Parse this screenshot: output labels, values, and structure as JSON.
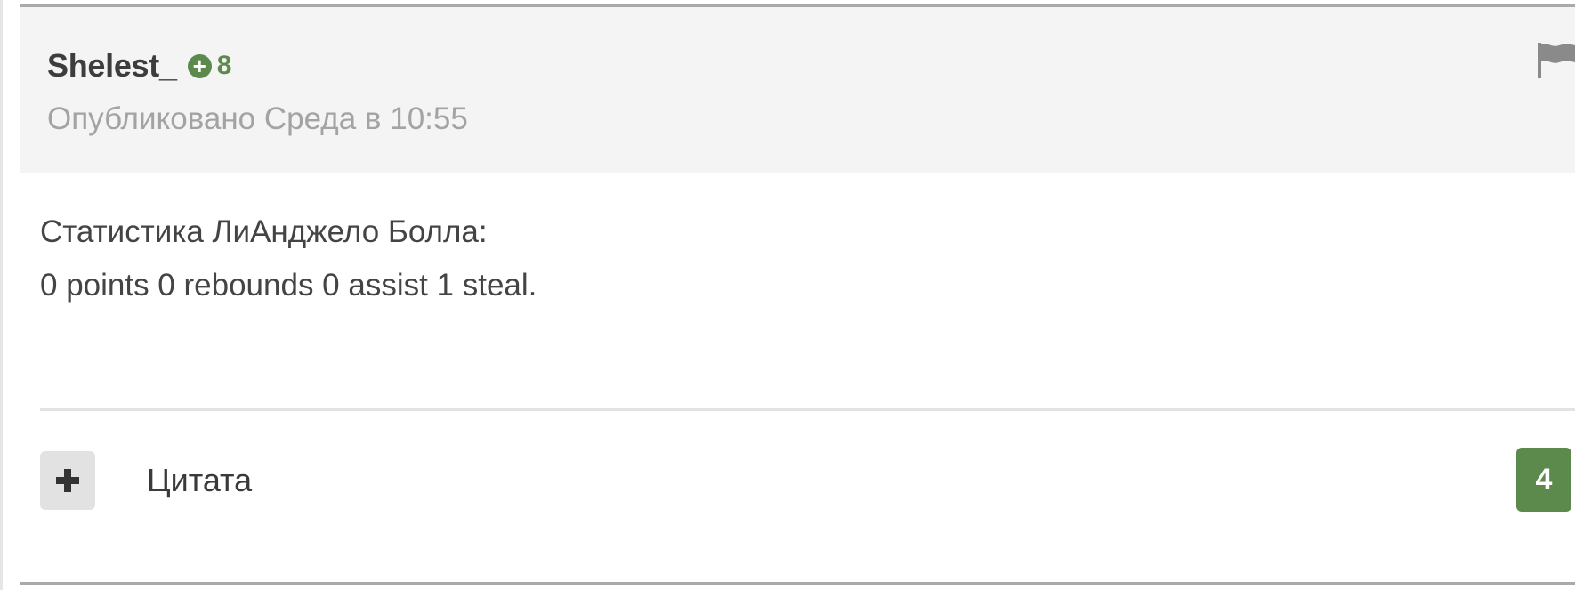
{
  "post": {
    "author": "Shelest_",
    "reputation_icon": "plus-circle-icon",
    "reputation": "8",
    "date": "Опубликовано Среда в 10:55",
    "body_lines": [
      "Статистика ЛиАнджело Болла:",
      "0 points 0 rebounds 0 assist 1 steal."
    ],
    "report_icon": "flag-icon",
    "actions": {
      "multiquote_icon": "plus-icon",
      "quote_label": "Цитата",
      "like_count": "4"
    }
  },
  "colors": {
    "header_bg": "#f4f4f4",
    "reputation_green": "#5b8a4c",
    "like_green": "#5b8a4c",
    "muted_text": "#a3a3a3"
  }
}
